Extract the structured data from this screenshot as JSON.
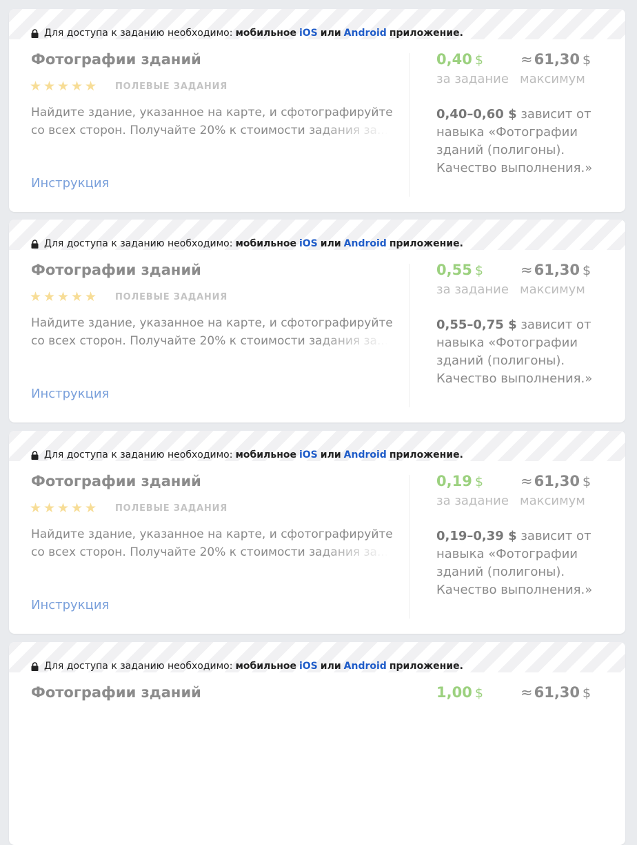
{
  "access": {
    "prefix": "Для доступа к заданию необходимо:",
    "mobile": "мобильное",
    "ios": "iOS",
    "or": "или",
    "android": "Android",
    "app": "приложение."
  },
  "colors": {
    "price": "#9cd17f",
    "link": "#7aa0db",
    "platform": "#1f5cc8",
    "star": "#f7dd97"
  },
  "cards": [
    {
      "title": "Фотографии зданий",
      "category": "ПОЛЕВЫЕ ЗАДАНИЯ",
      "rating_stars": 5,
      "desc_line1": "Найдите здание, указанное на карте, и сфотографируйте его",
      "desc_line2": "со всех сторон. Получайте 20% к стоимости задания за...",
      "instruction": "Инструкция",
      "price": "0,40",
      "currency": "$",
      "price_label": "за задание",
      "approx": "≈",
      "max": "61,30",
      "max_label": "максимум",
      "range": "0,40–0,60 $",
      "range_text": " зависит от навыка «Фотографии зданий (полигоны). Качество выполнения.»"
    },
    {
      "title": "Фотографии зданий",
      "category": "ПОЛЕВЫЕ ЗАДАНИЯ",
      "rating_stars": 5,
      "desc_line1": "Найдите здание, указанное на карте, и сфотографируйте его",
      "desc_line2": "со всех сторон. Получайте 20% к стоимости задания за...",
      "instruction": "Инструкция",
      "price": "0,55",
      "currency": "$",
      "price_label": "за задание",
      "approx": "≈",
      "max": "61,30",
      "max_label": "максимум",
      "range": "0,55–0,75 $",
      "range_text": " зависит от навыка «Фотографии зданий (полигоны). Качество выполнения.»"
    },
    {
      "title": "Фотографии зданий",
      "category": "ПОЛЕВЫЕ ЗАДАНИЯ",
      "rating_stars": 5,
      "desc_line1": "Найдите здание, указанное на карте, и сфотографируйте его",
      "desc_line2": "со всех сторон. Получайте 20% к стоимости задания за...",
      "instruction": "Инструкция",
      "price": "0,19",
      "currency": "$",
      "price_label": "за задание",
      "approx": "≈",
      "max": "61,30",
      "max_label": "максимум",
      "range": "0,19–0,39 $",
      "range_text": " зависит от навыка «Фотографии зданий (полигоны). Качество выполнения.»"
    },
    {
      "title": "Фотографии зданий",
      "price": "1,00",
      "currency": "$",
      "approx": "≈",
      "max": "61,30"
    }
  ]
}
